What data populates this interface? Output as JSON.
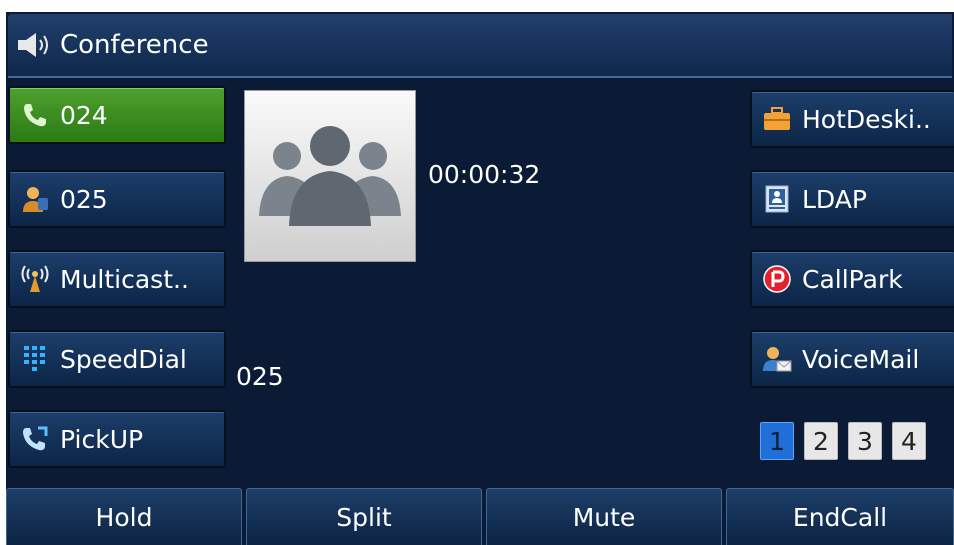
{
  "header": {
    "title": "Conference",
    "icon": "speaker-icon"
  },
  "line_keys_left": [
    {
      "label": "024",
      "icon": "handset-icon",
      "active": true
    },
    {
      "label": "025",
      "icon": "contact-person-icon",
      "active": false
    },
    {
      "label": "Multicast..",
      "icon": "antenna-icon",
      "active": false
    },
    {
      "label": "SpeedDial",
      "icon": "keypad-icon",
      "active": false
    },
    {
      "label": "PickUP",
      "icon": "pickup-handset-icon",
      "active": false
    }
  ],
  "call": {
    "duration": "00:00:32",
    "callee": "025",
    "avatar": "conference-group-icon"
  },
  "line_keys_right": [
    {
      "label": "HotDeski..",
      "icon": "briefcase-icon"
    },
    {
      "label": "LDAP",
      "icon": "directory-book-icon"
    },
    {
      "label": "CallPark",
      "icon": "park-p-icon"
    },
    {
      "label": "VoiceMail",
      "icon": "voicemail-person-icon"
    }
  ],
  "pages": {
    "items": [
      "1",
      "2",
      "3",
      "4"
    ],
    "current": "1"
  },
  "softkeys": [
    "Hold",
    "Split",
    "Mute",
    "EndCall"
  ],
  "colors": {
    "background": "#0b1b36",
    "active_key": "#3a8f22",
    "current_page": "#1f6fd6"
  }
}
